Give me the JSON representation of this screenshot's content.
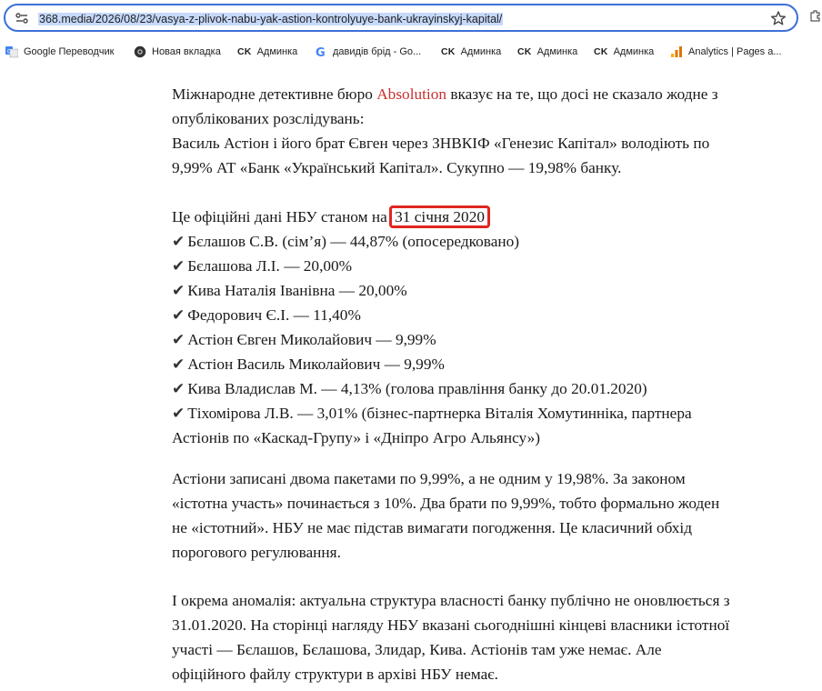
{
  "browser": {
    "url": "368.media/2026/08/23/vasya-z-plivok-nabu-yak-astion-kontrolyuye-bank-ukrayinskyj-kapital/",
    "bookmarks": [
      {
        "label": "Google Переводчик",
        "icon": "google-translate-icon"
      },
      {
        "label": "Новая вкладка",
        "icon": "chrome-icon"
      },
      {
        "label": "Админка",
        "badge": "CK"
      },
      {
        "label": "давидів брід - Go...",
        "icon": "google-g-icon"
      },
      {
        "label": "Админка",
        "badge": "CK"
      },
      {
        "label": "Админка",
        "badge": "CK"
      },
      {
        "label": "Админка",
        "badge": "CK"
      },
      {
        "label": "Analytics | Pages a...",
        "icon": "analytics-icon"
      }
    ]
  },
  "article": {
    "p1": {
      "line1_pre": "Міжнародне детективне бюро ",
      "brand": "Absolution",
      "line1_post": " вказує на те, що досі не сказало жодне з",
      "line2": "опублікованих розслідувань:",
      "line3": "Василь Астіон і його брат Євген через ЗНВКІФ «Генезис Капітал» володіють по",
      "line4": "9,99% АТ «Банк «Український Капітал». Сукупно — 19,98% банку."
    },
    "p2": {
      "intro": "Це офіційні дані НБУ станом на ",
      "date": "31 січня 2020",
      "check": "✔",
      "items": [
        "Бєлашов С.В. (сім’я) — 44,87% (опосередковано)",
        "Бєлашова Л.І. — 20,00%",
        "Кива Наталія Іванівна — 20,00%",
        "Федорович Є.І. — 11,40%",
        "Астіон Євген Миколайович — 9,99%",
        "Астіон Василь Миколайович — 9,99%",
        "Кива Владислав М. — 4,13% (голова правління банку до 20.01.2020)",
        "Тіхомірова Л.В. — 3,01% (бізнес-партнерка Віталія Хомутинніка, партнера"
      ],
      "last_continuation": "Астіонів по «Каскад-Групу» і «Дніпро Агро Альянсу»)"
    },
    "p3": [
      "Астіони записані двома пакетами по 9,99%, а не одним у 19,98%. За законом",
      "«істотна участь» починається з 10%. Два брати по 9,99%, тобто формально жоден",
      "не «істотний». НБУ не має підстав вимагати погодження. Це класичний обхід",
      "порогового регулювання."
    ],
    "p4": [
      "І окрема аномалія: актуальна структура власності банку публічно не оновлюється з",
      "31.01.2020. На сторінці нагляду НБУ вказані сьогоднішні кінцеві власники істотної",
      "участі — Бєлашов, Бєлашова, Злидар, Кива. Астіонів там уже немає. Але",
      "офіційного файлу структури в архіві НБУ немає."
    ]
  },
  "colors": {
    "brand": "#c8312f",
    "highlight_border": "#e0261f",
    "url_selection": "#c6d9fb",
    "omnibox_border": "#3d6fd8"
  }
}
